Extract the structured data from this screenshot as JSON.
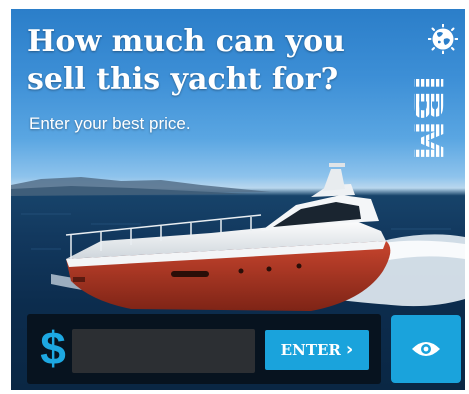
{
  "ad": {
    "headline": "How much can you sell this yacht for?",
    "subhead": "Enter your best price.",
    "brand": "IBM"
  },
  "price_form": {
    "currency_symbol": "$",
    "input_value": "",
    "enter_label": "ENTER",
    "enter_chevron": "›"
  },
  "icons": {
    "globe": "globe-icon",
    "chevron": "chevron-right-icon",
    "reveal": "eye-icon"
  },
  "colors": {
    "accent": "#1aa3dc",
    "bar": "#07131f",
    "input": "#2c2f33",
    "hull": "#b33a26"
  }
}
